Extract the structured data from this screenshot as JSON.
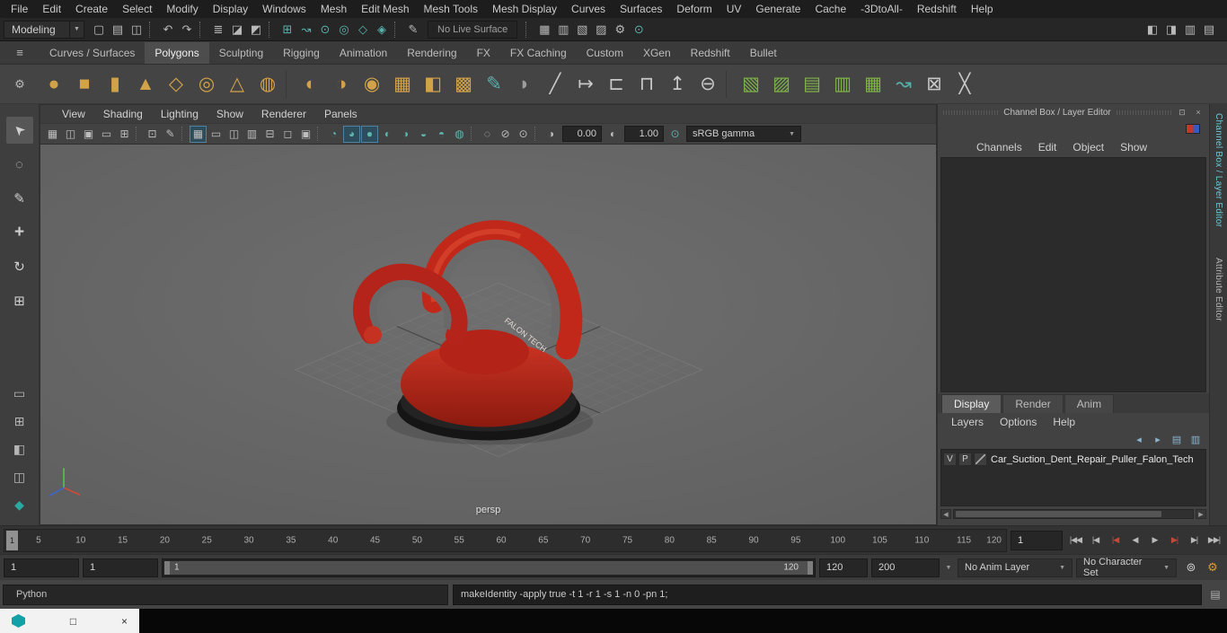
{
  "glyphs": {
    "dropdown_arrow": "▼",
    "menu": "≡",
    "gear": "⚙",
    "float": "⊡",
    "close": "×",
    "scroll_left": "◀",
    "scroll_right": "▶",
    "restore": "□",
    "script_editor": "▤",
    "exposure_icon": "◑",
    "gamma_icon": "◐",
    "color_mgmt_icon": "⊙"
  },
  "menu_bar": {
    "items": [
      "File",
      "Edit",
      "Create",
      "Select",
      "Modify",
      "Display",
      "Windows",
      "Mesh",
      "Edit Mesh",
      "Mesh Tools",
      "Mesh Display",
      "Curves",
      "Surfaces",
      "Deform",
      "UV",
      "Generate",
      "Cache",
      "-3DtoAll-",
      "Redshift",
      "Help"
    ]
  },
  "status_line": {
    "mode": "Modeling",
    "live_surface": "No Live Surface",
    "icons_left": [
      {
        "name": "new-scene-icon",
        "glyph": "▢"
      },
      {
        "name": "open-scene-icon",
        "glyph": "▤"
      },
      {
        "name": "save-scene-icon",
        "glyph": "◫"
      },
      {
        "name": "separator",
        "cls": "sep"
      },
      {
        "name": "undo-icon",
        "glyph": "↶"
      },
      {
        "name": "redo-icon",
        "glyph": "↷"
      },
      {
        "name": "separator",
        "cls": "sep"
      },
      {
        "name": "select-by-hierarchy-icon",
        "glyph": "≣"
      },
      {
        "name": "select-by-object-icon",
        "glyph": "◪"
      },
      {
        "name": "select-by-component-icon",
        "glyph": "◩"
      },
      {
        "name": "separator",
        "cls": "sep"
      },
      {
        "name": "snap-to-grid-icon",
        "glyph": "⊞",
        "color": "#58b1a9"
      },
      {
        "name": "snap-to-curve-icon",
        "glyph": "↝",
        "color": "#58b1a9"
      },
      {
        "name": "snap-to-point-icon",
        "glyph": "⊙",
        "color": "#58b1a9"
      },
      {
        "name": "snap-to-projected-center-icon",
        "glyph": "◎",
        "color": "#58b1a9"
      },
      {
        "name": "snap-to-view-plane-icon",
        "glyph": "◇",
        "color": "#58b1a9"
      },
      {
        "name": "make-object-live-icon",
        "glyph": "◈",
        "color": "#58b1a9"
      },
      {
        "name": "separator",
        "cls": "sep"
      },
      {
        "name": "construction-history-icon",
        "glyph": "✎"
      }
    ],
    "icons_right": [
      {
        "name": "separator",
        "cls": "sep"
      },
      {
        "name": "open-render-view-icon",
        "glyph": "▦"
      },
      {
        "name": "render-current-frame-icon",
        "glyph": "▥"
      },
      {
        "name": "ipr-render-icon",
        "glyph": "▧"
      },
      {
        "name": "render-sequence-icon",
        "glyph": "▨"
      },
      {
        "name": "render-settings-icon",
        "glyph": "⚙"
      },
      {
        "name": "color-management-icon",
        "glyph": "⊙",
        "color": "#58b1a9"
      }
    ],
    "icons_far": [
      {
        "name": "toggle-modeling-toolkit-icon",
        "glyph": "◧"
      },
      {
        "name": "toggle-attribute-editor-icon",
        "glyph": "◨"
      },
      {
        "name": "toggle-tool-settings-icon",
        "glyph": "▥"
      },
      {
        "name": "toggle-channel-box-icon",
        "glyph": "▤"
      }
    ]
  },
  "shelf": {
    "tabs": [
      {
        "label": "Curves / Surfaces"
      },
      {
        "label": "Polygons",
        "active": true
      },
      {
        "label": "Sculpting"
      },
      {
        "label": "Rigging"
      },
      {
        "label": "Animation"
      },
      {
        "label": "Rendering"
      },
      {
        "label": "FX"
      },
      {
        "label": "FX Caching"
      },
      {
        "label": "Custom"
      },
      {
        "label": "XGen"
      },
      {
        "label": "Redshift"
      },
      {
        "label": "Bullet"
      }
    ],
    "icons": [
      {
        "name": "poly-sphere-icon",
        "glyph": "●",
        "color": "#d2a249"
      },
      {
        "name": "poly-cube-icon",
        "glyph": "■",
        "color": "#d2a249"
      },
      {
        "name": "poly-cylinder-icon",
        "glyph": "▮",
        "color": "#d2a249"
      },
      {
        "name": "poly-cone-icon",
        "glyph": "▲",
        "color": "#d2a249"
      },
      {
        "name": "poly-plane-icon",
        "glyph": "◇",
        "color": "#d2a249"
      },
      {
        "name": "poly-torus-icon",
        "glyph": "◎",
        "color": "#d2a249"
      },
      {
        "name": "poly-pyramid-icon",
        "glyph": "△",
        "color": "#d2a249"
      },
      {
        "name": "poly-pipe-icon",
        "glyph": "◍",
        "color": "#d2a249"
      },
      {
        "name": "separator",
        "cls": "sep"
      },
      {
        "name": "smooth-mesh-icon",
        "glyph": "◐",
        "color": "#d2a249"
      },
      {
        "name": "subdiv-proxy-icon",
        "glyph": "◑",
        "color": "#d2a249"
      },
      {
        "name": "poly-disc-icon",
        "glyph": "◉",
        "color": "#d2a249"
      },
      {
        "name": "poly-grid-icon",
        "glyph": "▦",
        "color": "#d2a249"
      },
      {
        "name": "beveled-cube-icon",
        "glyph": "◧",
        "color": "#d2a249"
      },
      {
        "name": "dense-plane-icon",
        "glyph": "▩",
        "color": "#d2a249"
      },
      {
        "name": "quad-draw-icon",
        "glyph": "✎",
        "color": "#55b2aa"
      },
      {
        "name": "sculpt-tool-icon",
        "glyph": "◗",
        "color": "#9c9c9c"
      },
      {
        "name": "multi-cut-icon",
        "glyph": "╱",
        "color": "#c8c8c8"
      },
      {
        "name": "target-weld-icon",
        "glyph": "↦",
        "color": "#c8c8c8"
      },
      {
        "name": "bevel-icon",
        "glyph": "⊏",
        "color": "#c8c8c8"
      },
      {
        "name": "bridge-icon",
        "glyph": "⊓",
        "color": "#c8c8c8"
      },
      {
        "name": "extrude-icon",
        "glyph": "↥",
        "color": "#c8c8c8"
      },
      {
        "name": "boolean-icon",
        "glyph": "⊖",
        "color": "#c8c8c8"
      },
      {
        "name": "separator",
        "cls": "sep"
      },
      {
        "name": "smooth-icon",
        "glyph": "▧",
        "color": "#7fb347"
      },
      {
        "name": "reduce-icon",
        "glyph": "▨",
        "color": "#7fb347"
      },
      {
        "name": "retopologize-icon",
        "glyph": "▤",
        "color": "#7fb347"
      },
      {
        "name": "remesh-icon",
        "glyph": "▥",
        "color": "#7fb347"
      },
      {
        "name": "conform-icon",
        "glyph": "▦",
        "color": "#7fb347"
      },
      {
        "name": "curve-warp-icon",
        "glyph": "↝",
        "color": "#55b2aa"
      },
      {
        "name": "frame-mesh-icon",
        "glyph": "⊠",
        "color": "#c8c8c8"
      },
      {
        "name": "delete-history-icon",
        "glyph": "╳",
        "color": "#c8c8c8"
      }
    ]
  },
  "toolbox": {
    "tools": [
      {
        "name": "select-tool",
        "glyph": "➤",
        "cls": "rot",
        "active": true
      },
      {
        "name": "lasso-tool",
        "glyph": "◌"
      },
      {
        "name": "paint-select-tool",
        "glyph": "✎"
      },
      {
        "name": "move-tool",
        "glyph": "+",
        "cls": "bold"
      },
      {
        "name": "rotate-tool",
        "glyph": "↻"
      },
      {
        "name": "scale-tool",
        "glyph": "⊞"
      }
    ],
    "layouts": [
      {
        "name": "single-pane-layout",
        "glyph": "▭"
      },
      {
        "name": "four-pane-layout",
        "glyph": "⊞"
      },
      {
        "name": "outliner-persp-layout",
        "glyph": "◧"
      },
      {
        "name": "split-pane-layout",
        "glyph": "◫"
      },
      {
        "name": "maya-home-icon",
        "glyph": "◆",
        "color": "#2aa8a2"
      }
    ]
  },
  "viewport": {
    "menu": [
      "View",
      "Shading",
      "Lighting",
      "Show",
      "Renderer",
      "Panels"
    ],
    "toolbar_icons": [
      {
        "name": "select-camera-icon",
        "glyph": "▦"
      },
      {
        "name": "lock-camera-icon",
        "glyph": "◫"
      },
      {
        "name": "camera-attributes-icon",
        "glyph": "▣"
      },
      {
        "name": "bookmarks-icon",
        "glyph": "▭"
      },
      {
        "name": "image-plane-icon",
        "glyph": "⊞"
      },
      {
        "name": "separator",
        "cls": "sep"
      },
      {
        "name": "2d-pan-zoom-icon",
        "glyph": "⊡"
      },
      {
        "name": "grease-pencil-icon",
        "glyph": "✎"
      },
      {
        "name": "separator",
        "cls": "sep"
      },
      {
        "name": "grid-toggle-icon",
        "glyph": "▦",
        "active": true
      },
      {
        "name": "film-gate-icon",
        "glyph": "▭"
      },
      {
        "name": "resolution-gate-icon",
        "glyph": "◫"
      },
      {
        "name": "gate-mask-icon",
        "glyph": "▥"
      },
      {
        "name": "field-chart-icon",
        "glyph": "⊟"
      },
      {
        "name": "safe-action-icon",
        "glyph": "◻"
      },
      {
        "name": "safe-title-icon",
        "glyph": "▣"
      },
      {
        "name": "separator",
        "cls": "sep"
      },
      {
        "name": "wireframe-mode-icon",
        "glyph": "◔",
        "color": "#5fb6ae"
      },
      {
        "name": "shaded-mode-icon",
        "glyph": "◕",
        "color": "#5fb6ae",
        "active": true
      },
      {
        "name": "textured-mode-icon",
        "glyph": "●",
        "color": "#5fb6ae",
        "active": true
      },
      {
        "name": "use-all-lights-icon",
        "glyph": "◐",
        "color": "#5fb6ae"
      },
      {
        "name": "shadows-icon",
        "glyph": "◑",
        "color": "#5fb6ae"
      },
      {
        "name": "screen-space-ao-icon",
        "glyph": "◒",
        "color": "#5fb6ae"
      },
      {
        "name": "motion-blur-icon",
        "glyph": "◓",
        "color": "#5fb6ae"
      },
      {
        "name": "anti-aliasing-icon",
        "glyph": "◍",
        "color": "#5fb6ae"
      },
      {
        "name": "separator",
        "cls": "sep"
      },
      {
        "name": "isolate-select-icon",
        "glyph": "◌"
      },
      {
        "name": "x-ray-icon",
        "glyph": "⊘"
      },
      {
        "name": "x-ray-joints-icon",
        "glyph": "⊙"
      },
      {
        "name": "separator",
        "cls": "sep"
      }
    ],
    "exposure": "0.00",
    "gamma": "1.00",
    "view_transform": "sRGB gamma",
    "camera_label": "persp",
    "model_label": "FALON TECH"
  },
  "channel_box": {
    "title": "Channel Box / Layer Editor",
    "menu": [
      "Channels",
      "Edit",
      "Object",
      "Show"
    ],
    "tabs": [
      {
        "label": "Display",
        "active": true
      },
      {
        "label": "Render"
      },
      {
        "label": "Anim"
      }
    ],
    "layer_menu": [
      "Layers",
      "Options",
      "Help"
    ],
    "layer_icons": [
      {
        "name": "move-selected-to-layer-icon",
        "glyph": "◂",
        "color": "#8ab4cf"
      },
      {
        "name": "select-layer-objects-icon",
        "glyph": "▸",
        "color": "#8ab4cf"
      },
      {
        "name": "create-empty-layer-icon",
        "glyph": "▤",
        "color": "#8ab4cf"
      },
      {
        "name": "create-layer-from-selected-icon",
        "glyph": "▥",
        "color": "#8ab4cf"
      }
    ],
    "layer": {
      "visibility": "V",
      "playback": "P",
      "name": "Car_Suction_Dent_Repair_Puller_Falon_Tech"
    }
  },
  "side_tabs": [
    {
      "label": "Channel Box / Layer Editor",
      "active": true
    },
    {
      "label": "Attribute Editor"
    }
  ],
  "time_slider": {
    "current_frame": "1",
    "frame_field": "1",
    "ticks": [
      {
        "label": "5",
        "left": "3.4%"
      },
      {
        "label": "10",
        "left": "7.6%"
      },
      {
        "label": "15",
        "left": "11.8%"
      },
      {
        "label": "20",
        "left": "16%"
      },
      {
        "label": "25",
        "left": "20.2%"
      },
      {
        "label": "30",
        "left": "24.4%"
      },
      {
        "label": "35",
        "left": "28.6%"
      },
      {
        "label": "40",
        "left": "32.8%"
      },
      {
        "label": "45",
        "left": "37%"
      },
      {
        "label": "50",
        "left": "41.2%"
      },
      {
        "label": "55",
        "left": "45.4%"
      },
      {
        "label": "60",
        "left": "49.6%"
      },
      {
        "label": "65",
        "left": "53.8%"
      },
      {
        "label": "70",
        "left": "58%"
      },
      {
        "label": "75",
        "left": "62.2%"
      },
      {
        "label": "80",
        "left": "66.4%"
      },
      {
        "label": "85",
        "left": "70.6%"
      },
      {
        "label": "90",
        "left": "74.8%"
      },
      {
        "label": "95",
        "left": "79%"
      },
      {
        "label": "100",
        "left": "83.2%"
      },
      {
        "label": "105",
        "left": "87.4%"
      },
      {
        "label": "110",
        "left": "91.6%"
      },
      {
        "label": "115",
        "left": "95.8%"
      },
      {
        "label": "120",
        "left": "98.8%"
      }
    ],
    "playback": [
      {
        "name": "go-to-playback-start-button",
        "glyph": "|◀◀"
      },
      {
        "name": "step-back-one-frame-button",
        "glyph": "|◀"
      },
      {
        "name": "step-back-one-key-button",
        "glyph": "|◀",
        "color": "#c0493a"
      },
      {
        "name": "play-backwards-button",
        "glyph": "◀"
      },
      {
        "name": "play-forwards-button",
        "glyph": "▶"
      },
      {
        "name": "step-forward-one-key-button",
        "glyph": "▶|",
        "color": "#c0493a"
      },
      {
        "name": "step-forward-one-frame-button",
        "glyph": "▶|"
      },
      {
        "name": "go-to-playback-end-button",
        "glyph": "▶▶|"
      }
    ]
  },
  "range_slider": {
    "animation_start": "1",
    "playback_start": "1",
    "bar_start": "1",
    "bar_end": "120",
    "playback_end": "120",
    "animation_end": "200",
    "anim_layer": "No Anim Layer",
    "character_set": "No Character Set",
    "icons": [
      {
        "name": "auto-keyframe-icon",
        "glyph": "⊚",
        "color": "#cfcfcf"
      },
      {
        "name": "animation-preferences-icon",
        "glyph": "⚙",
        "color": "#d79a3c"
      }
    ]
  },
  "command_line": {
    "language": "Python",
    "history": "makeIdentity -apply true -t 1 -r 1 -s 1 -n 0 -pn 1;"
  }
}
